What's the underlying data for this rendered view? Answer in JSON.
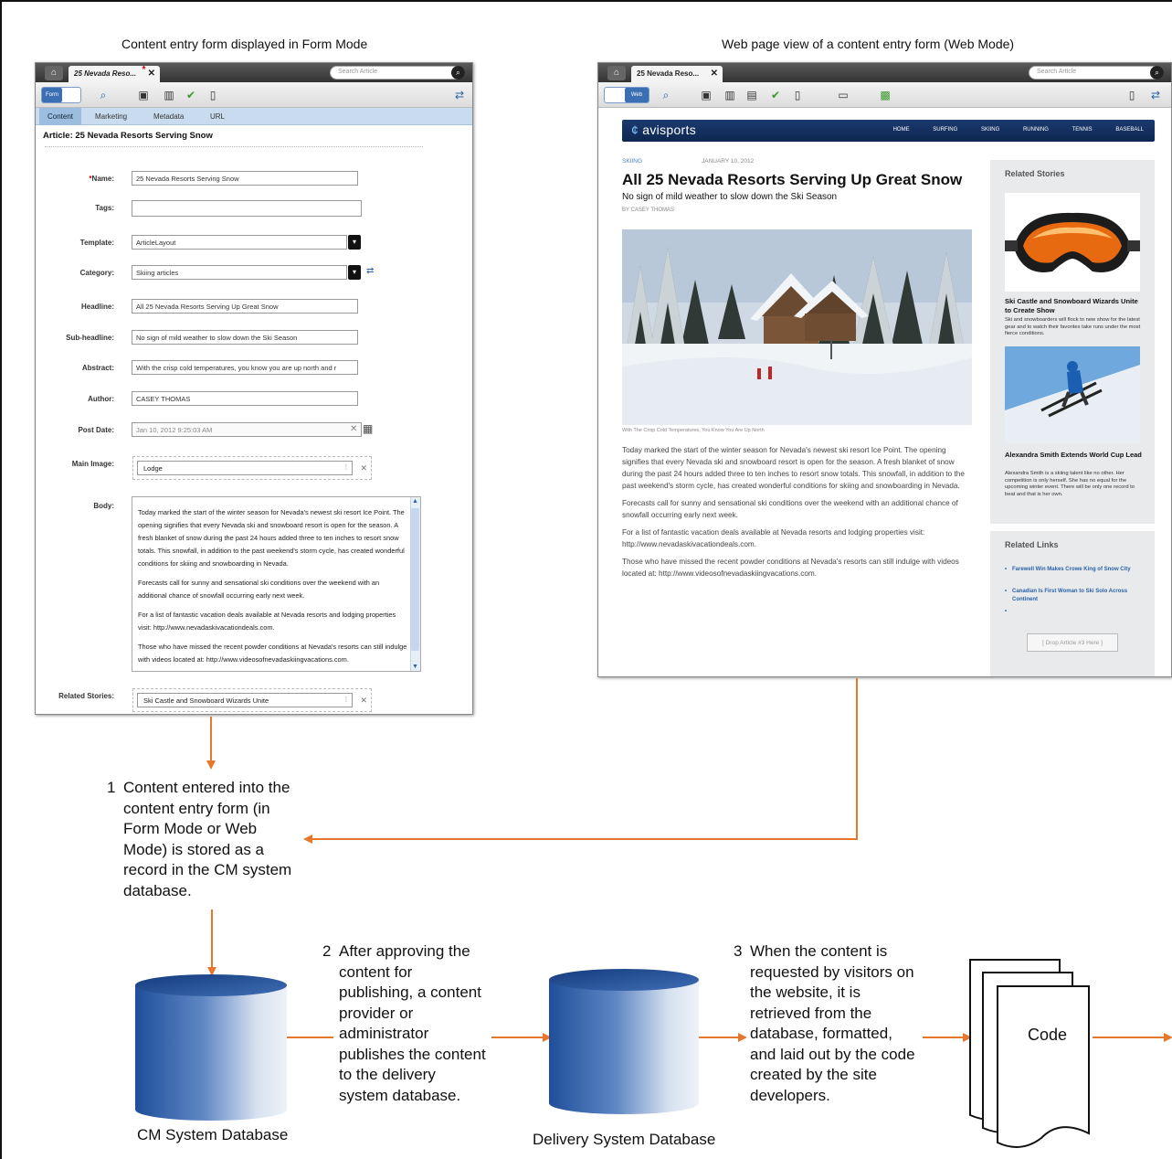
{
  "captions": {
    "form_mode": "Content entry form displayed in Form Mode",
    "web_mode": "Web page view of a content entry form (Web Mode)"
  },
  "form_window": {
    "tab_title": "25 Nevada Reso...",
    "search_placeholder": "Search Article",
    "mode_button": "Form",
    "subtabs": [
      "Content",
      "Marketing",
      "Metadata",
      "URL"
    ],
    "article_title": "Article: 25 Nevada Resorts Serving Snow",
    "fields": {
      "name": {
        "label": "Name:",
        "required_mark": "*",
        "value": "25 Nevada Resorts Serving Snow"
      },
      "tags": {
        "label": "Tags:",
        "value": ""
      },
      "template": {
        "label": "Template:",
        "value": "ArticleLayout"
      },
      "category": {
        "label": "Category:",
        "value": "Skiing articles"
      },
      "headline": {
        "label": "Headline:",
        "value": "All 25 Nevada Resorts Serving Up Great Snow"
      },
      "subheadline": {
        "label": "Sub-headline:",
        "value": "No sign of mild weather to slow down the Ski Season"
      },
      "abstract": {
        "label": "Abstract:",
        "value": "With the crisp cold temperatures, you know you are up north and r"
      },
      "author": {
        "label": "Author:",
        "value": "CASEY THOMAS"
      },
      "post_date": {
        "label": "Post Date:",
        "value": "Jan 10, 2012 9:25:03 AM"
      },
      "main_image": {
        "label": "Main Image:",
        "value": "Lodge"
      },
      "body": {
        "label": "Body:"
      },
      "related_stories": {
        "label": "Related Stories:",
        "value": "Ski Castle and Snowboard Wizards Unite"
      }
    },
    "body_paragraphs": [
      "Today marked the start of the winter season for Nevada's newest ski resort Ice Point. The opening signifies that every Nevada ski and snowboard resort is open for the season. A fresh blanket of snow during the past 24 hours added three to ten inches to resort snow totals. This snowfall, in addition to the past weekend's storm cycle, has created wonderful conditions for skiing and snowboarding in Nevada.",
      "Forecasts call for sunny and sensational ski conditions over the weekend with an additional chance of snowfall occurring early next week.",
      "For a list of fantastic vacation deals available at Nevada resorts and lodging properties visit: http://www.nevadaskivacationdeals.com.",
      "Those who have missed the recent powder conditions at Nevada's resorts can still indulge with videos located at: http://www.videosofnevadaskiingvacations.com."
    ]
  },
  "web_window": {
    "tab_title": "25 Nevada Reso...",
    "search_placeholder": "Search Article",
    "mode_button": "Web",
    "logo": "avisports",
    "nav": [
      "HOME",
      "SURFING",
      "SKIING",
      "RUNNING",
      "TENNIS",
      "BASEBALL"
    ],
    "section": "SKIING",
    "date": "JANUARY 10, 2012",
    "headline": "All 25 Nevada Resorts Serving Up Great Snow",
    "subheadline": "No sign of mild weather to slow down the Ski Season",
    "byline": "BY CASEY THOMAS",
    "photo_credit": "With The Crisp Cold Temperatures, You Know You Are Up North",
    "body": [
      "Today marked the start of the winter season for Nevada's newest ski resort Ice Point. The opening signifies that every Nevada ski and snowboard resort is open for the season. A fresh blanket of snow during the past 24 hours added three to ten inches to resort snow totals. This snowfall, in addition to the past weekend's storm cycle, has created wonderful conditions for skiing and snowboarding in Nevada.",
      "Forecasts call for sunny and sensational ski conditions over the weekend with an additional chance of snowfall occurring early next week.",
      "For a list of fantastic vacation deals available at Nevada resorts and lodging properties visit: http://www.nevadaskivacationdeals.com.",
      "Those who have missed the recent powder conditions at Nevada's resorts can still indulge with videos located at: http://www.videosofnevadaskiingvacations.com."
    ],
    "related_stories_heading": "Related Stories",
    "stories": [
      {
        "title": "Ski Castle and Snowboard Wizards Unite to Create Show",
        "desc": "Ski and snowboarders will flock to new show for the latest gear and to watch their favorites take runs under the most fierce conditions."
      },
      {
        "title": "Alexandra Smith Extends World Cup Lead",
        "desc": "Alexandra Smith is a skiing talent like no other. Her competition is only herself. She has no equal for the upcoming winter event. There will be only one record to beat and that is her own."
      }
    ],
    "related_links_heading": "Related Links",
    "links": [
      "Farewell Win Makes Crowe King of Snow City",
      "Canadian Is First Woman to Ski Solo Across Continent"
    ],
    "drop_placeholder": "[ Drop Article #3 Here ]"
  },
  "steps": {
    "one": {
      "num": "1",
      "lines": [
        "Content entered into the",
        "content entry form (in",
        "Form Mode or Web",
        "Mode) is stored as a",
        "record in the CM system",
        "database."
      ]
    },
    "two": {
      "num": "2",
      "lines": [
        "After approving the",
        "content for",
        "publishing, a content",
        "provider or",
        "administrator",
        "publishes the content",
        "to the delivery",
        "system database."
      ]
    },
    "three": {
      "num": "3",
      "lines": [
        "When the content is",
        "requested by visitors on",
        "the website, it is",
        "retrieved from the",
        "database, formatted,",
        "and laid out by the code",
        "created by the site",
        "developers."
      ]
    }
  },
  "databases": {
    "cm": "CM System Database",
    "delivery": "Delivery System Database"
  },
  "code_label": "Code",
  "colors": {
    "arrow": "#e8772e",
    "cylinder_dark": "#1f4f9a",
    "cylinder_light": "#e8eef7",
    "site_nav": "#0e2651"
  },
  "icons": [
    "home-icon",
    "search-icon",
    "save-icon",
    "binoculars-icon",
    "checkmark-icon",
    "trash-icon",
    "sync-icon",
    "calendar-icon",
    "dropdown-icon",
    "mobile-icon"
  ]
}
